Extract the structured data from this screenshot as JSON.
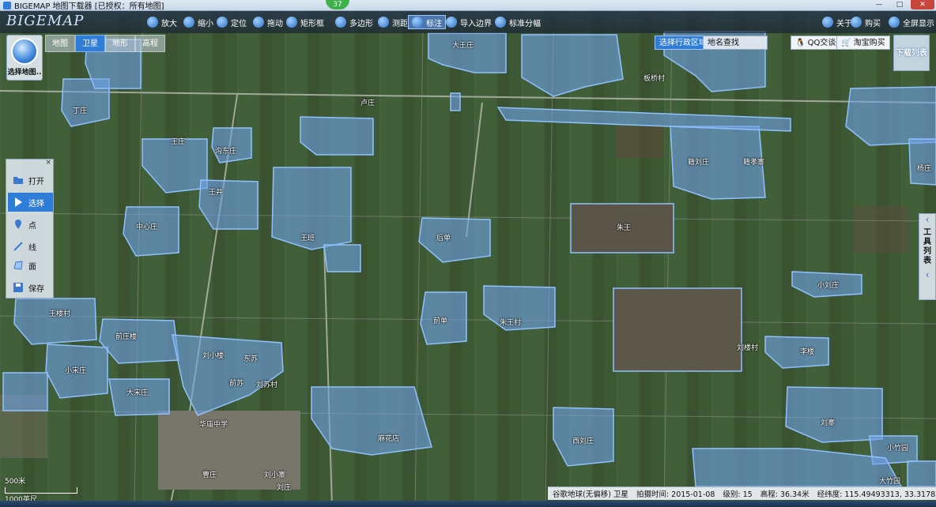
{
  "window": {
    "title": "BIGEMAP 地图下载器 [已授权：所有地图]",
    "badge": "37",
    "min_label": "—",
    "max_label": "□",
    "close_label": "✕"
  },
  "toolbar": {
    "logo": "BIGEMAP",
    "tools": [
      {
        "label": "放大",
        "icon": "zoom-in-icon"
      },
      {
        "label": "缩小",
        "icon": "zoom-out-icon"
      },
      {
        "label": "定位",
        "icon": "locate-icon"
      },
      {
        "label": "拖动",
        "icon": "hand-icon"
      },
      {
        "label": "矩形框",
        "icon": "rectangle-icon"
      },
      {
        "label": "多边形",
        "icon": "polygon-icon"
      },
      {
        "label": "测距",
        "icon": "ruler-icon"
      },
      {
        "label": "标注",
        "icon": "marker-icon"
      },
      {
        "label": "导入边界",
        "icon": "import-icon"
      },
      {
        "label": "标准分幅",
        "icon": "grid-icon"
      },
      {
        "label": "关于",
        "icon": "info-icon"
      },
      {
        "label": "购买",
        "icon": "cart-icon"
      },
      {
        "label": "全屏显示",
        "icon": "fullscreen-icon"
      }
    ],
    "active_tool": "标注"
  },
  "map_switcher": {
    "select_map_label": "选择地图..",
    "types": [
      "地图",
      "卫星",
      "地形",
      "高程"
    ],
    "active": "卫星"
  },
  "top_right": {
    "admin_region": "选择行政区域",
    "place_search": "地名查找",
    "qq": "QQ交谈",
    "taobao": "淘宝购买",
    "download_list": "下载列表"
  },
  "left_panel": {
    "items": [
      {
        "label": "打开",
        "icon": "folder-icon"
      },
      {
        "label": "选择",
        "icon": "pointer-icon"
      },
      {
        "label": "点",
        "icon": "pin-icon"
      },
      {
        "label": "线",
        "icon": "line-icon"
      },
      {
        "label": "面",
        "icon": "polygon-area-icon"
      },
      {
        "label": "保存",
        "icon": "save-icon"
      }
    ],
    "active": "选择",
    "close": "×"
  },
  "right_panel": {
    "label": "工具列表",
    "arrow_up": "‹",
    "arrow_down": "‹"
  },
  "villages": [
    "大王庄",
    "丁庄",
    "卢庄",
    "沟东庄",
    "王庄",
    "王井",
    "中心庄",
    "王班",
    "后单",
    "朱王",
    "板桥村",
    "籍刘庄",
    "籍孝寨",
    "杨庄",
    "小刘庄",
    "王楼村",
    "前庄楼",
    "刘小楼",
    "东苏",
    "前苏",
    "刘苏村",
    "小宋庄",
    "大宋庄",
    "前单",
    "朱王村",
    "刘楼村",
    "李楼",
    "麻花店",
    "西刘庄",
    "刘寨",
    "小竹园",
    "大竹园",
    "华庙中学",
    "刘小寨",
    "曹庄",
    "刘庄"
  ],
  "scale": {
    "metric": "500米",
    "imperial": "1000英尺"
  },
  "status": {
    "source": "谷歌地球(无偏移) 卫星",
    "date": "拍摄时间: 2015-01-08",
    "level": "级别: 15",
    "elevation": "高程: 36.34米",
    "coords": "经纬度: 115.49493313, 33.31782831"
  },
  "colors": {
    "accent": "#2f7dd6",
    "village_fill": "#6fa2e6",
    "field": "#3f5a36"
  }
}
